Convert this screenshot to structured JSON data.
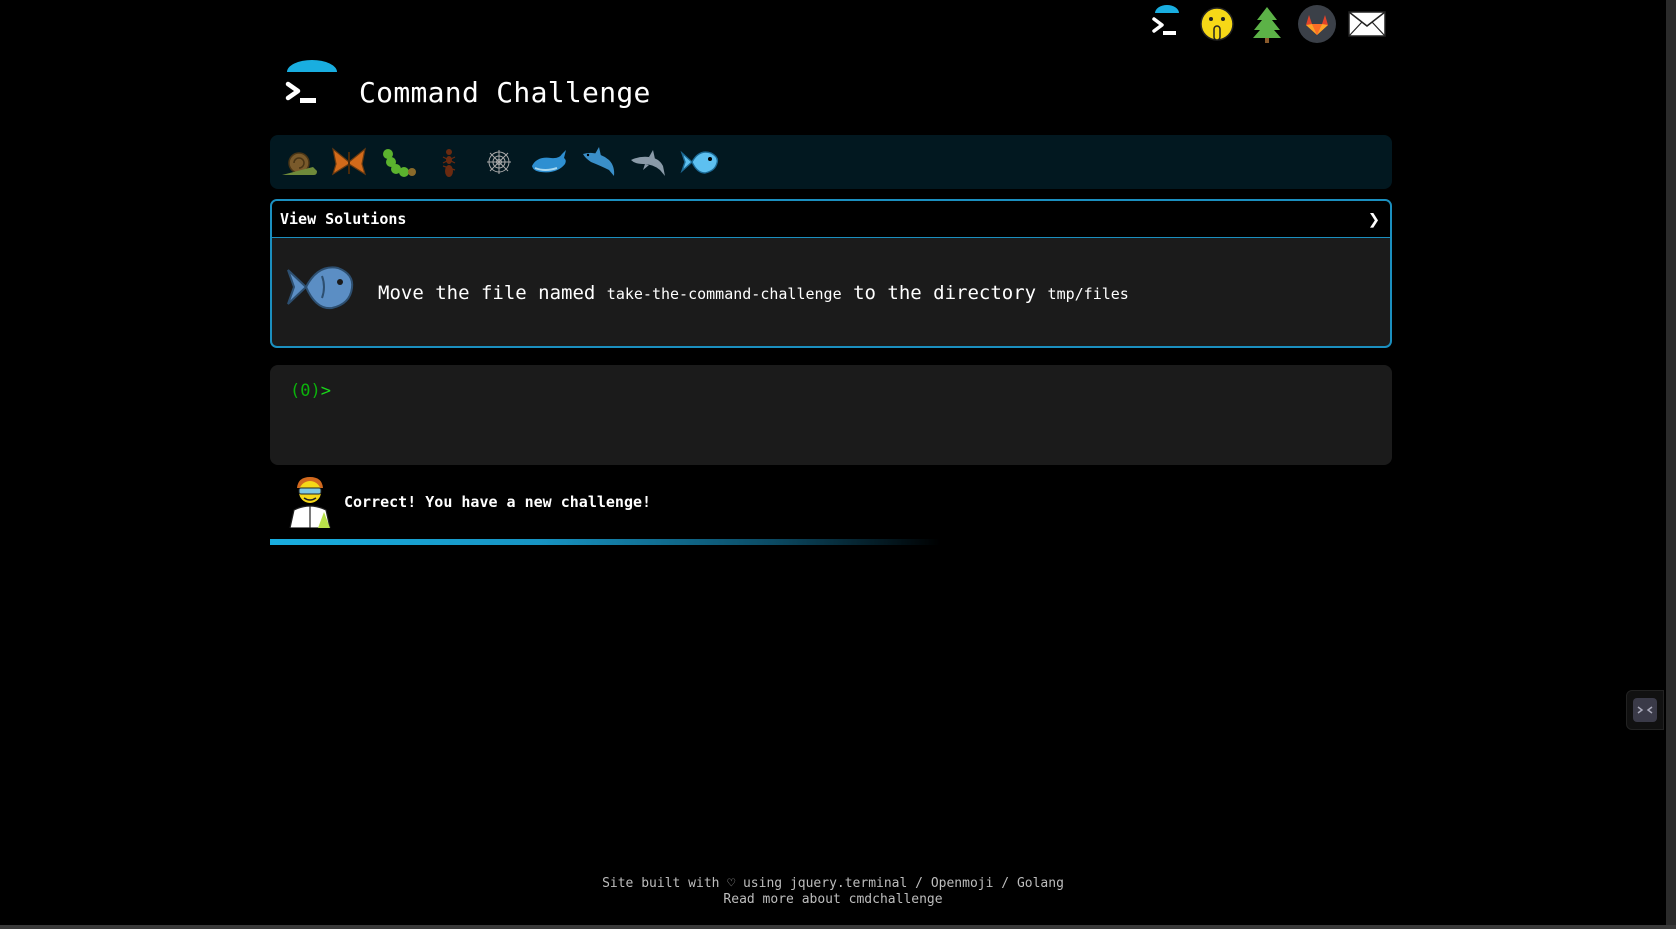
{
  "header": {
    "title": "Command Challenge"
  },
  "top_icons": [
    {
      "name": "terminal-icon"
    },
    {
      "name": "shushing-face-icon"
    },
    {
      "name": "tree-icon"
    },
    {
      "name": "gitlab-icon"
    },
    {
      "name": "envelope-icon"
    }
  ],
  "levels": [
    {
      "name": "snail-icon"
    },
    {
      "name": "butterfly-icon"
    },
    {
      "name": "caterpillar-icon"
    },
    {
      "name": "ant-icon"
    },
    {
      "name": "spider-web-icon"
    },
    {
      "name": "whale-icon"
    },
    {
      "name": "shark-icon"
    },
    {
      "name": "dolphin-icon"
    },
    {
      "name": "fish-icon"
    }
  ],
  "card": {
    "header_label": "View Solutions",
    "chevron": "❯",
    "task": {
      "prefix": "Move the file named",
      "file": "take-the-command-challenge",
      "middle": "to the directory",
      "dir": "tmp/files"
    }
  },
  "terminal": {
    "prompt_num": "(0)",
    "prompt_sym": ">"
  },
  "status": {
    "message": "Correct! You have a new challenge!",
    "progress": 1.0
  },
  "footer": {
    "line1_prefix": "Site built with",
    "heart": "♡",
    "using": "using",
    "link1": "jquery.terminal",
    "sep1": "/",
    "link2": "Openmoji",
    "sep2": "/",
    "link3": "Golang",
    "line2_prefix": "Read more about",
    "link4": "cmdchallenge"
  },
  "colors": {
    "accent": "#1b8fbf",
    "prompt": "#19d819",
    "progress": "#19aee0"
  }
}
